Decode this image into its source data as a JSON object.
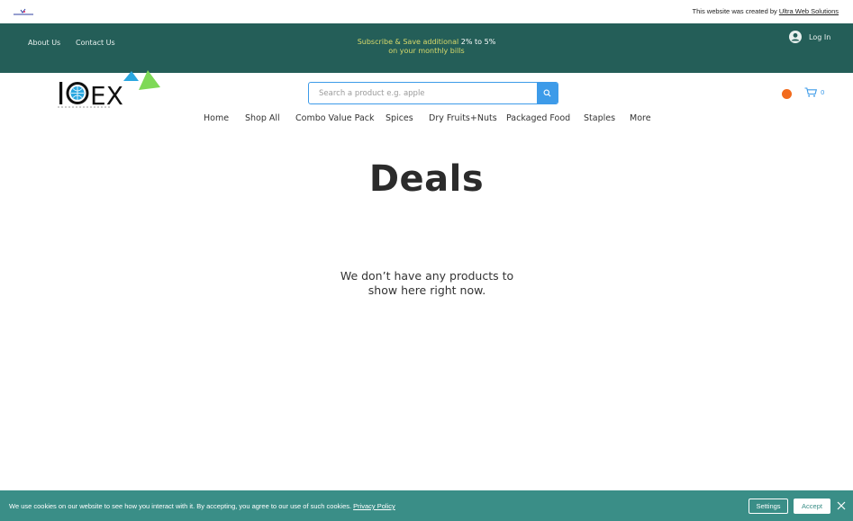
{
  "credit": {
    "prefix": "This website was created by ",
    "link": "Ultra Web Solutions"
  },
  "header": {
    "about": "About Us",
    "contact": "Contact Us",
    "promo_line1_highlight": "Subscribe & Save additional ",
    "promo_line1_rest": "2% to 5%",
    "promo_line2": "on your monthly bills",
    "login": "Log In"
  },
  "brand": {
    "text": "IOEX",
    "colors": {
      "triangle_blue": "#2aa7e0",
      "triangle_green": "#7ed957"
    }
  },
  "search": {
    "placeholder": "Search a product e.g. apple"
  },
  "cart": {
    "count": "0"
  },
  "nav": {
    "items": [
      "Home",
      "Shop All",
      "Combo Value Pack",
      "Spices",
      "Dry Fruits+Nuts",
      "Packaged Food",
      "Staples",
      "More"
    ]
  },
  "main": {
    "title": "Deals",
    "empty_message": "We don’t have any products to show here right now."
  },
  "cookie": {
    "text": "We use cookies on our website to see how you interact with it. By accepting, you agree to our use of such cookies.",
    "policy_link": "Privacy Policy",
    "settings": "Settings",
    "accept": "Accept"
  },
  "colors": {
    "header_bg": "#245e58",
    "accent_blue": "#3d9be9",
    "cookie_bg": "#3a8e87",
    "orange": "#f26b1d"
  }
}
